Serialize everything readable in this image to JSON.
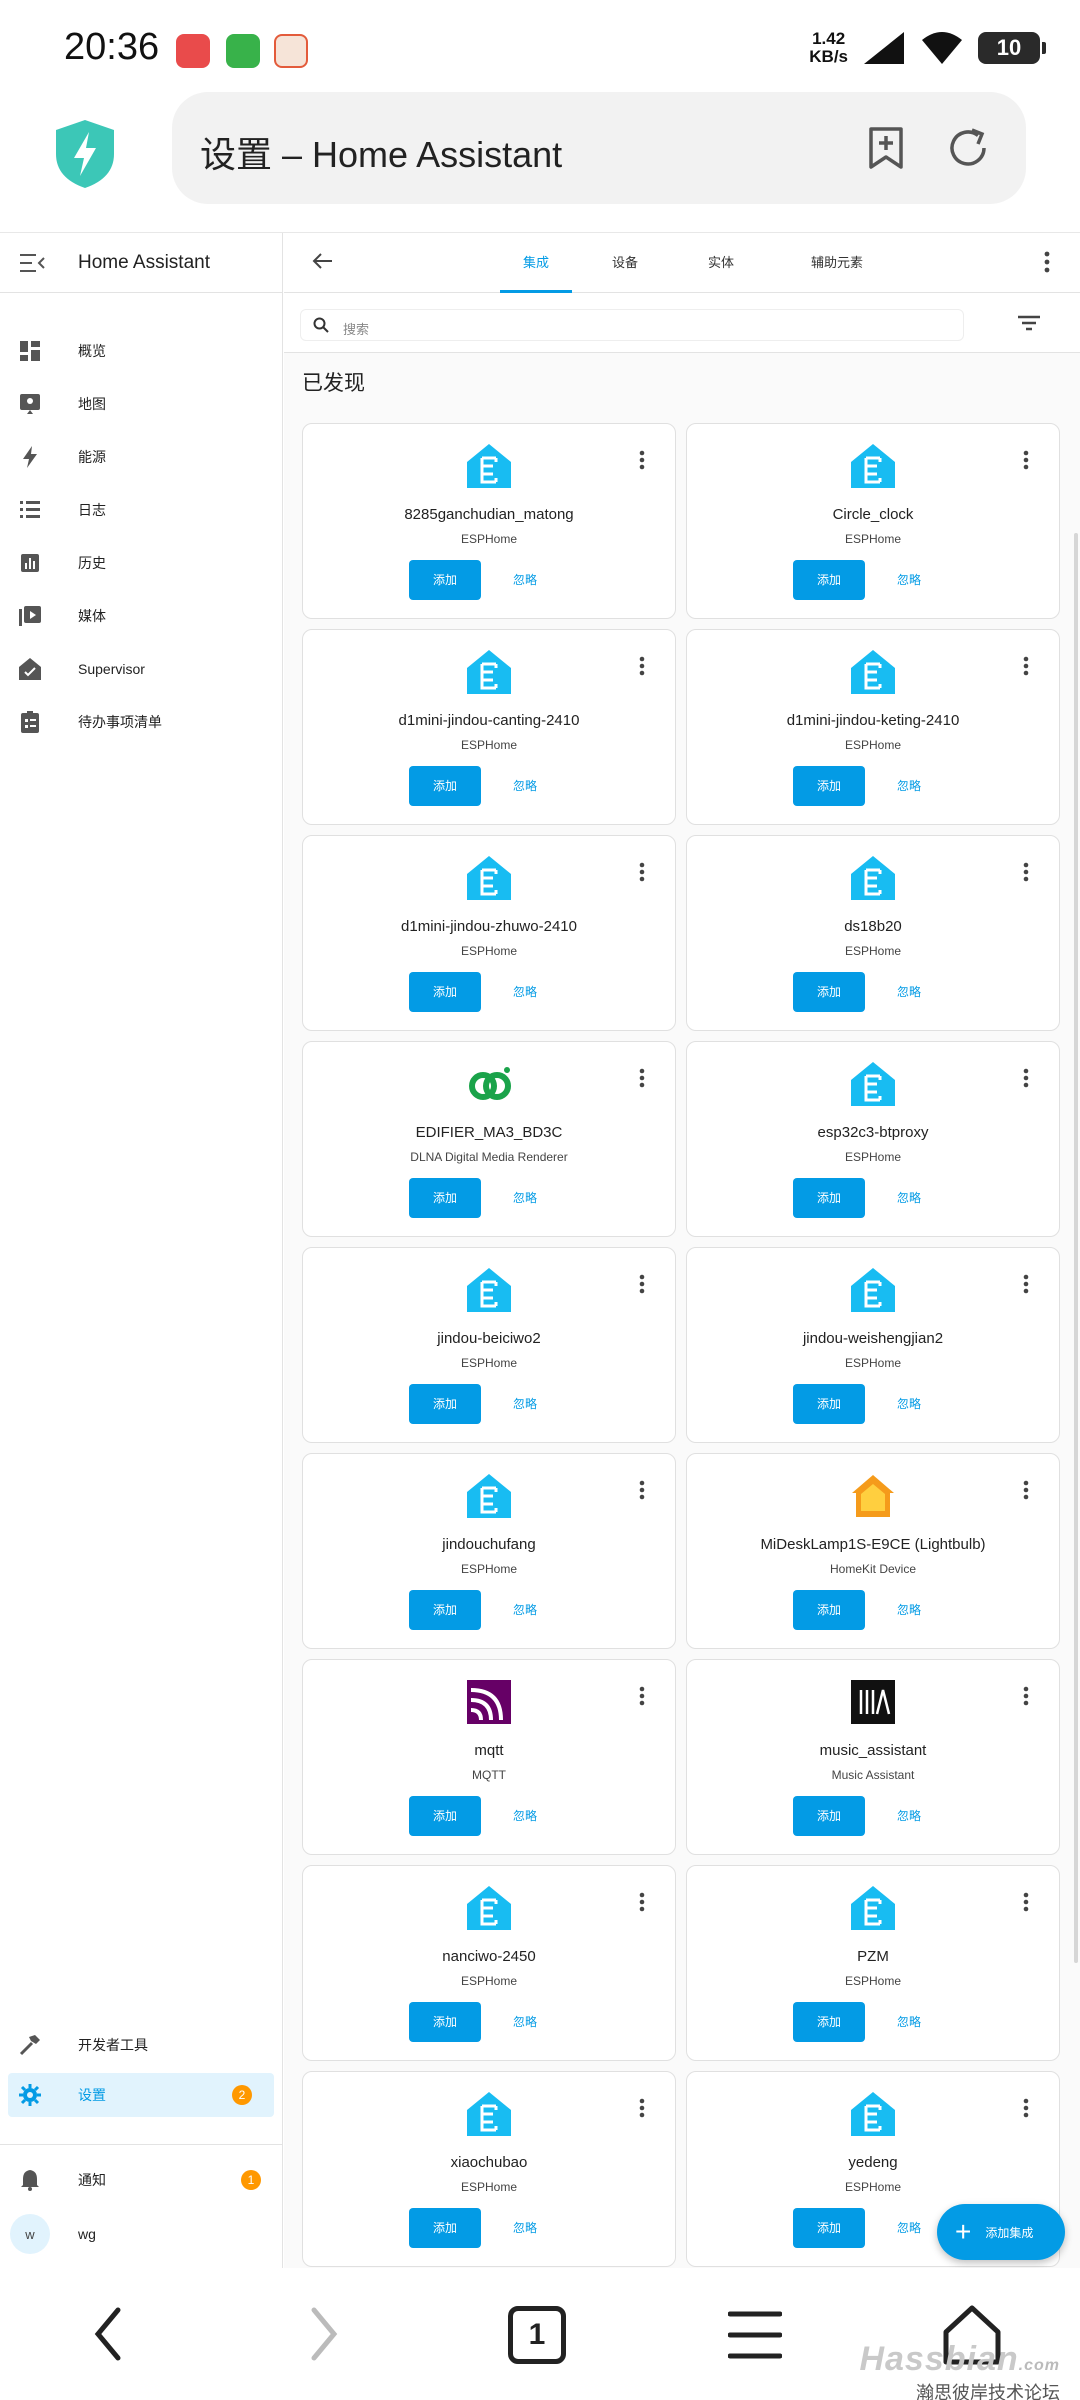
{
  "status_bar": {
    "time": "20:36",
    "net_speed_value": "1.42",
    "net_speed_unit": "KB/s",
    "battery": "10"
  },
  "browser": {
    "page_title": "设置 – Home Assistant"
  },
  "sidebar": {
    "title": "Home Assistant",
    "items": [
      {
        "label": "概览",
        "icon": "dashboard-icon"
      },
      {
        "label": "地图",
        "icon": "map-icon"
      },
      {
        "label": "能源",
        "icon": "energy-icon"
      },
      {
        "label": "日志",
        "icon": "logbook-icon"
      },
      {
        "label": "历史",
        "icon": "history-icon"
      },
      {
        "label": "媒体",
        "icon": "media-icon"
      },
      {
        "label": "Supervisor",
        "icon": "supervisor-icon"
      },
      {
        "label": "待办事项清单",
        "icon": "todo-icon"
      }
    ],
    "dev_tools": "开发者工具",
    "settings": "设置",
    "settings_badge": "2",
    "notifications": "通知",
    "notifications_badge": "1",
    "user_initial": "w",
    "user_name": "wg"
  },
  "toolbar": {
    "tabs": [
      "集成",
      "设备",
      "实体",
      "辅助元素"
    ],
    "active_tab": "集成"
  },
  "search": {
    "placeholder": "搜索"
  },
  "section_title": "已发现",
  "buttons": {
    "add": "添加",
    "ignore": "忽略"
  },
  "cards": [
    {
      "name": "8285ganchudian_matong",
      "type": "ESPHome",
      "logo": "esphome"
    },
    {
      "name": "Circle_clock",
      "type": "ESPHome",
      "logo": "esphome"
    },
    {
      "name": "d1mini-jindou-canting-2410",
      "type": "ESPHome",
      "logo": "esphome"
    },
    {
      "name": "d1mini-jindou-keting-2410",
      "type": "ESPHome",
      "logo": "esphome"
    },
    {
      "name": "d1mini-jindou-zhuwo-2410",
      "type": "ESPHome",
      "logo": "esphome"
    },
    {
      "name": "ds18b20",
      "type": "ESPHome",
      "logo": "esphome"
    },
    {
      "name": "EDIFIER_MA3_BD3C",
      "type": "DLNA Digital Media Renderer",
      "logo": "dlna"
    },
    {
      "name": "esp32c3-btproxy",
      "type": "ESPHome",
      "logo": "esphome"
    },
    {
      "name": "jindou-beiciwo2",
      "type": "ESPHome",
      "logo": "esphome"
    },
    {
      "name": "jindou-weishengjian2",
      "type": "ESPHome",
      "logo": "esphome"
    },
    {
      "name": "jindouchufang",
      "type": "ESPHome",
      "logo": "esphome"
    },
    {
      "name": "MiDeskLamp1S-E9CE (Lightbulb)",
      "type": "HomeKit Device",
      "logo": "homekit"
    },
    {
      "name": "mqtt",
      "type": "MQTT",
      "logo": "mqtt"
    },
    {
      "name": "music_assistant",
      "type": "Music Assistant",
      "logo": "music"
    },
    {
      "name": "nanciwo-2450",
      "type": "ESPHome",
      "logo": "esphome"
    },
    {
      "name": "PZM",
      "type": "ESPHome",
      "logo": "esphome"
    },
    {
      "name": "xiaochubao",
      "type": "ESPHome",
      "logo": "esphome"
    },
    {
      "name": "yedeng",
      "type": "ESPHome",
      "logo": "esphome"
    }
  ],
  "fab_label": "添加集成",
  "watermark": {
    "logo": "Hassbian",
    "suffix": ".com",
    "subtitle": "瀚思彼岸技术论坛"
  },
  "bottom_nav": {
    "tab_count": "1"
  },
  "colors": {
    "accent": "#039be5",
    "badge": "#ff9800",
    "esphome": "#18bcf2"
  }
}
